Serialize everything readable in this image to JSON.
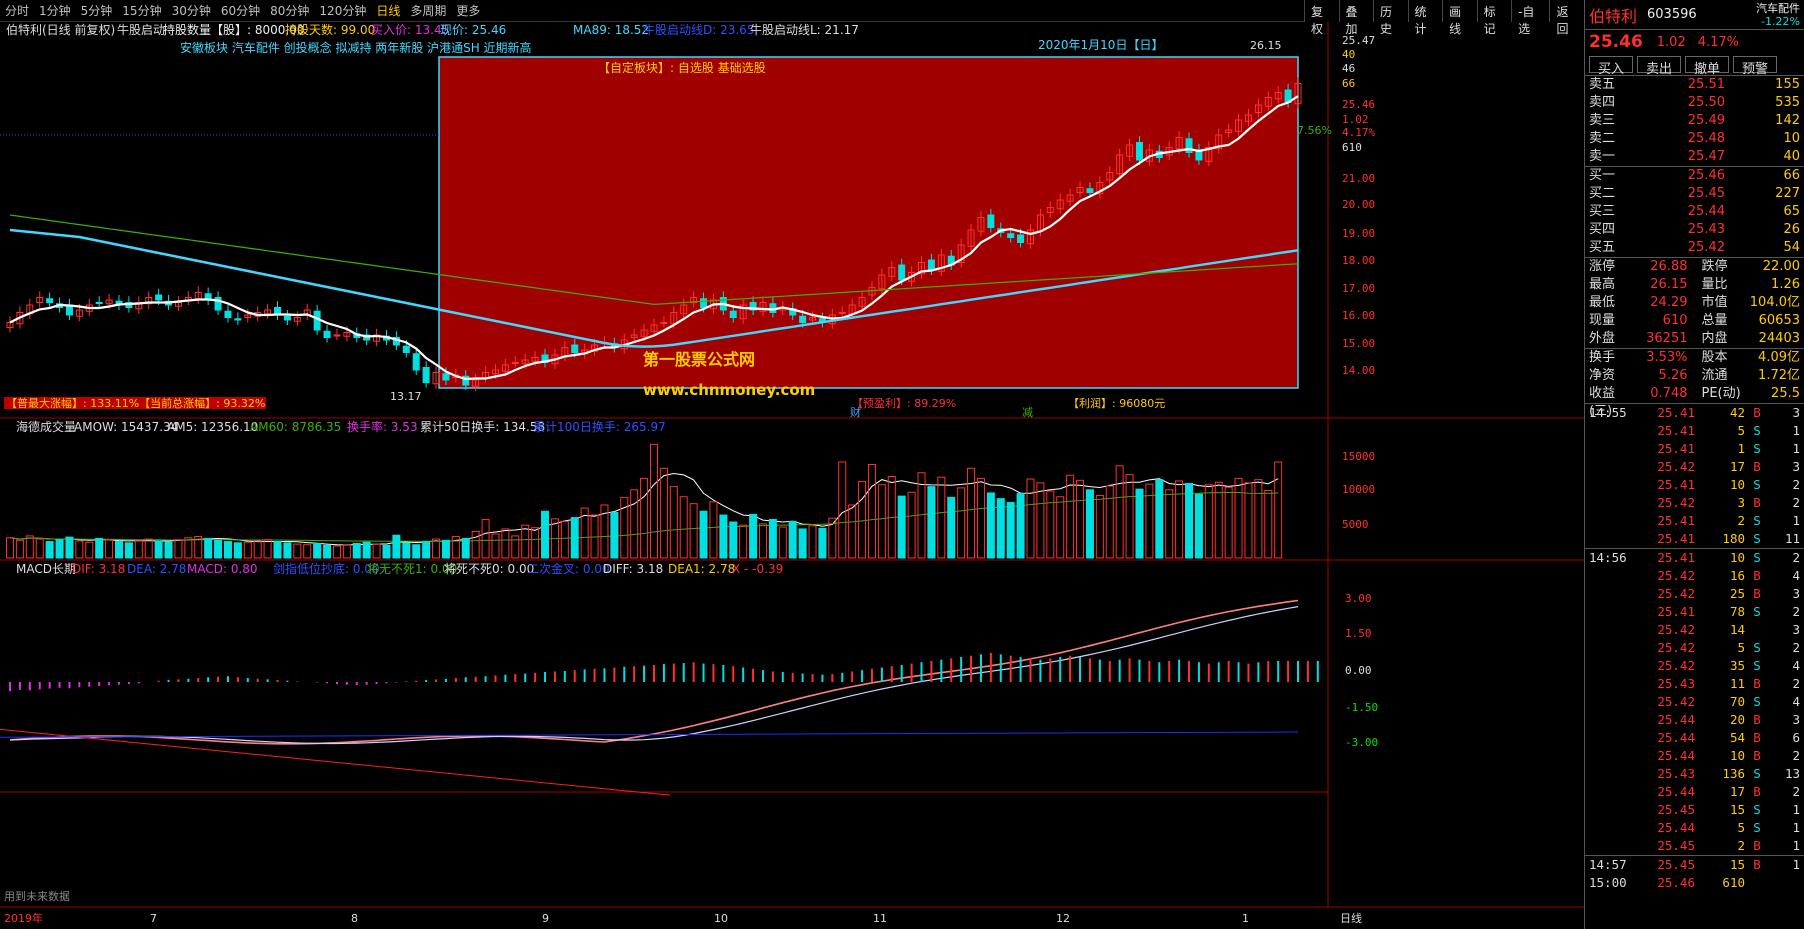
{
  "periods": [
    "分时",
    "1分钟",
    "5分钟",
    "15分钟",
    "30分钟",
    "60分钟",
    "80分钟",
    "120分钟",
    "日线",
    "多周期",
    "更多"
  ],
  "active_period": "日线",
  "right_tools": [
    "复权",
    "叠加",
    "历史",
    "统计",
    "画线",
    "标记",
    "-自选",
    "返回"
  ],
  "main_title": "伯特利(日线 前复权)",
  "main_sub": "牛股启动",
  "holdings": "持股数量【股】: 8000.00",
  "hold_days": "持股天数: 99.00",
  "buy_price": "买入价: 13.45",
  "cur_price": "现价: 25.46",
  "ma89": "MA89: 18.52",
  "start_line_d": "牛股启动线D: 23.65",
  "start_line_l": "牛股启动线L: 21.17",
  "concepts": "安徽板块 汽车配件 创投概念 拟减持 两年新股 沪港通SH 近期新高",
  "date_label": "2020年1月10日【日】",
  "custom_block": "【自定板块】: 自选股 基础选股",
  "max_gain": "【普最大涨幅】: 133.11%【当前总涨幅】: 93.32%",
  "profit_pct": "【预盈利】: 89.29%",
  "profit_amt": "【利润】: 96080元",
  "watermark1": "第一股票公式网",
  "watermark2": "www.chnmoney.com",
  "label_low": "13.17",
  "label_high": "26.15",
  "mark_cai": "财",
  "mark_jian": "减",
  "vol_title": "海德成交量",
  "vol_amow": "AMOW: 15437.34",
  "vol_am5": "AM5: 12356.10",
  "vol_am60": "AM60: 8786.35",
  "vol_turn": "换手率: 3.53",
  "vol_turn50": "累计50日换手: 134.58",
  "vol_turn100": "累计100日换手: 265.97",
  "macd_title": "MACD长期",
  "macd_dif": "DIF: 3.18",
  "macd_dea": "DEA: 2.78",
  "macd_macd": "MACD: 0.80",
  "macd_i1": "剑指低位抄底: 0.00",
  "macd_i2": "将无不死1: 0.00",
  "macd_i3": "将死不死0: 0.00",
  "macd_i4": "二次金叉: 0.00",
  "macd_i5": "DIFF: 3.18",
  "macd_i6": "DEA1: 2.78",
  "macd_i7": "X - -0.39",
  "footer_note": "用到未来数据",
  "x_labels": [
    "2019年",
    "7",
    "8",
    "9",
    "10",
    "11",
    "12",
    "1",
    "日线"
  ],
  "y_main": [
    "25.47",
    "40",
    "46",
    "66",
    "25.46",
    "1.02",
    "4.17%",
    "610",
    "21.00",
    "20.00",
    "19.00",
    "18.00",
    "17.00",
    "16.00",
    "15.00",
    "14.00"
  ],
  "y_vol": [
    "15000",
    "10000",
    "5000"
  ],
  "y_macd": [
    "3.00",
    "1.50",
    "0.00",
    "-1.50",
    "-3.00"
  ],
  "pct_right": "7.56%",
  "panel": {
    "name": "伯特利",
    "code": "603596",
    "sector": "汽车配件",
    "sector_chg": "-1.22%",
    "price": "25.46",
    "chg": "1.02",
    "chg_pct": "4.17%",
    "buttons": [
      "买入",
      "卖出",
      "撤单",
      "预警"
    ],
    "asks": [
      [
        "卖五",
        "25.51",
        "155"
      ],
      [
        "卖四",
        "25.50",
        "535"
      ],
      [
        "卖三",
        "25.49",
        "142"
      ],
      [
        "卖二",
        "25.48",
        "10"
      ],
      [
        "卖一",
        "25.47",
        "40"
      ]
    ],
    "bids": [
      [
        "买一",
        "25.46",
        "66"
      ],
      [
        "买二",
        "25.45",
        "227"
      ],
      [
        "买三",
        "25.44",
        "65"
      ],
      [
        "买四",
        "25.43",
        "26"
      ],
      [
        "买五",
        "25.42",
        "54"
      ]
    ],
    "stats": [
      [
        "涨停",
        "26.88",
        "跌停",
        "22.00"
      ],
      [
        "最高",
        "26.15",
        "量比",
        "1.26"
      ],
      [
        "最低",
        "24.29",
        "市值",
        "104.0亿"
      ],
      [
        "现量",
        "610",
        "总量",
        "60653"
      ],
      [
        "外盘",
        "36251",
        "内盘",
        "24403"
      ]
    ],
    "stats2": [
      [
        "换手",
        "3.53%",
        "股本",
        "4.09亿"
      ],
      [
        "净资",
        "5.26",
        "流通",
        "1.72亿"
      ],
      [
        "收益(三)",
        "0.748",
        "PE(动)",
        "25.5"
      ]
    ],
    "ticks1": [
      [
        "14:55",
        "25.41",
        "42",
        "B",
        "3"
      ],
      [
        "",
        "25.41",
        "5",
        "S",
        "1"
      ],
      [
        "",
        "25.41",
        "1",
        "S",
        "1"
      ],
      [
        "",
        "25.42",
        "17",
        "B",
        "3"
      ],
      [
        "",
        "25.41",
        "10",
        "S",
        "2"
      ],
      [
        "",
        "25.42",
        "3",
        "B",
        "2"
      ],
      [
        "",
        "25.41",
        "2",
        "S",
        "1"
      ],
      [
        "",
        "25.41",
        "180",
        "S",
        "11"
      ]
    ],
    "ticks2": [
      [
        "14:56",
        "25.41",
        "10",
        "S",
        "2"
      ],
      [
        "",
        "25.42",
        "16",
        "B",
        "4"
      ],
      [
        "",
        "25.42",
        "25",
        "B",
        "3"
      ],
      [
        "",
        "25.41",
        "78",
        "S",
        "2"
      ],
      [
        "",
        "25.42",
        "14",
        "",
        "3"
      ],
      [
        "",
        "25.42",
        "5",
        "S",
        "2"
      ],
      [
        "",
        "25.42",
        "35",
        "S",
        "4"
      ],
      [
        "",
        "25.43",
        "11",
        "B",
        "2"
      ],
      [
        "",
        "25.42",
        "70",
        "S",
        "4"
      ],
      [
        "",
        "25.44",
        "20",
        "B",
        "3"
      ],
      [
        "",
        "25.44",
        "54",
        "B",
        "6"
      ],
      [
        "",
        "25.44",
        "10",
        "B",
        "2"
      ],
      [
        "",
        "25.43",
        "136",
        "S",
        "13"
      ],
      [
        "",
        "25.44",
        "17",
        "B",
        "2"
      ],
      [
        "",
        "25.45",
        "15",
        "S",
        "1"
      ],
      [
        "",
        "25.44",
        "5",
        "S",
        "1"
      ],
      [
        "",
        "25.45",
        "2",
        "B",
        "1"
      ]
    ],
    "ticks3": [
      [
        "14:57",
        "25.45",
        "15",
        "B",
        "1"
      ],
      [
        "15:00",
        "25.46",
        "610",
        "",
        ""
      ]
    ]
  },
  "colors": {
    "up": "#ff3030",
    "down": "#00e0e0",
    "box": "#a00000",
    "ma_white": "#ffffff",
    "ma_cyan": "#40d8ff",
    "ma_green": "#3cb000"
  },
  "chart_data": {
    "type": "candlestick",
    "ylim": [
      12.8,
      27.2
    ],
    "closes": [
      15.9,
      16.3,
      16.6,
      16.9,
      16.7,
      16.5,
      16.2,
      16.4,
      16.6,
      16.7,
      16.8,
      16.6,
      16.5,
      16.7,
      16.9,
      16.8,
      16.6,
      16.7,
      16.9,
      17.1,
      16.8,
      16.4,
      16.1,
      16.0,
      16.2,
      16.3,
      16.4,
      16.2,
      16.0,
      16.1,
      16.4,
      15.6,
      15.3,
      15.4,
      15.5,
      15.3,
      15.2,
      15.4,
      15.2,
      15.0,
      14.7,
      14.0,
      13.5,
      13.9,
      13.6,
      13.8,
      13.4,
      13.6,
      13.9,
      14.0,
      14.2,
      14.3,
      14.4,
      14.5,
      14.3,
      14.6,
      14.9,
      14.7,
      14.8,
      15.0,
      15.1,
      14.9,
      15.2,
      15.4,
      15.6,
      15.8,
      15.9,
      16.3,
      16.6,
      16.9,
      16.5,
      16.8,
      16.4,
      16.1,
      16.6,
      16.4,
      16.7,
      16.3,
      16.5,
      16.2,
      15.9,
      16.1,
      15.9,
      16.2,
      16.3,
      16.6,
      16.9,
      17.3,
      17.8,
      18.1,
      17.6,
      17.9,
      18.3,
      18.0,
      18.6,
      18.2,
      19.0,
      19.6,
      20.1,
      19.7,
      19.5,
      19.3,
      19.1,
      19.6,
      20.2,
      20.5,
      20.8,
      21.0,
      21.3,
      21.1,
      21.5,
      21.9,
      22.6,
      23.0,
      22.4,
      22.8,
      22.5,
      22.9,
      23.3,
      22.7,
      22.4,
      22.9,
      23.4,
      23.6,
      24.0,
      24.2,
      24.6,
      24.9,
      25.1,
      24.7,
      25.46
    ],
    "volumes": [
      3200,
      2800,
      3500,
      3000,
      2600,
      2900,
      3300,
      2700,
      2500,
      3100,
      2900,
      2600,
      2400,
      2800,
      3000,
      2700,
      2500,
      2900,
      3200,
      3400,
      3100,
      2800,
      2600,
      2400,
      2500,
      2700,
      2900,
      2600,
      2400,
      2200,
      2100,
      2300,
      2000,
      1900,
      2100,
      2300,
      2500,
      2200,
      2000,
      3600,
      2400,
      2100,
      2600,
      3000,
      2800,
      3400,
      3100,
      4200,
      6100,
      3800,
      4600,
      3500,
      5200,
      4800,
      7400,
      6200,
      5800,
      6400,
      7900,
      6800,
      8400,
      7200,
      9600,
      10800,
      12600,
      18000,
      14200,
      11300,
      9700,
      8600,
      7400,
      8900,
      6800,
      5700,
      5200,
      6900,
      5400,
      6100,
      4900,
      5800,
      4600,
      5100,
      4700,
      6300,
      15200,
      8400,
      12100,
      14800,
      11600,
      12900,
      9800,
      10400,
      13500,
      11300,
      12800,
      9600,
      11100,
      14200,
      12600,
      10300,
      9400,
      8800,
      10200,
      12500,
      11900,
      10600,
      9700,
      13100,
      12300,
      10800,
      9900,
      11400,
      14600,
      13200,
      10900,
      11700,
      12400,
      10800,
      12200,
      11800,
      10100,
      11600,
      12000,
      11200,
      12600,
      11900,
      12400,
      10700,
      15200
    ],
    "macd_hist": [
      -0.35,
      -0.3,
      -0.32,
      -0.28,
      -0.25,
      -0.22,
      -0.24,
      -0.2,
      -0.18,
      -0.15,
      -0.12,
      -0.1,
      -0.08,
      -0.05,
      0.0,
      0.05,
      0.08,
      0.1,
      0.12,
      0.15,
      0.18,
      0.2,
      0.22,
      0.18,
      0.15,
      0.12,
      0.1,
      0.08,
      0.05,
      0.02,
      0.0,
      -0.02,
      -0.05,
      -0.08,
      -0.1,
      -0.12,
      -0.1,
      -0.08,
      -0.05,
      -0.02,
      0.02,
      0.05,
      0.08,
      0.1,
      0.12,
      0.15,
      0.18,
      0.2,
      0.22,
      0.25,
      0.28,
      0.3,
      0.32,
      0.35,
      0.38,
      0.4,
      0.42,
      0.45,
      0.48,
      0.5,
      0.52,
      0.55,
      0.58,
      0.6,
      0.62,
      0.65,
      0.68,
      0.7,
      0.72,
      0.75,
      0.7,
      0.68,
      0.65,
      0.6,
      0.55,
      0.5,
      0.45,
      0.4,
      0.38,
      0.35,
      0.32,
      0.3,
      0.28,
      0.3,
      0.35,
      0.4,
      0.45,
      0.5,
      0.55,
      0.6,
      0.65,
      0.7,
      0.75,
      0.8,
      0.85,
      0.9,
      0.95,
      1.0,
      1.05,
      1.1,
      1.05,
      1.0,
      0.95,
      0.9,
      0.85,
      0.9,
      0.95,
      1.0,
      0.95,
      0.9,
      0.85,
      0.8,
      0.85,
      0.9,
      0.85,
      0.8,
      0.75,
      0.8,
      0.85,
      0.8,
      0.75,
      0.7,
      0.75,
      0.8,
      0.75,
      0.7,
      0.75,
      0.8,
      0.8,
      0.8,
      0.8,
      0.8,
      0.8
    ],
    "macd_ylim": [
      -3.8,
      3.8
    ]
  }
}
